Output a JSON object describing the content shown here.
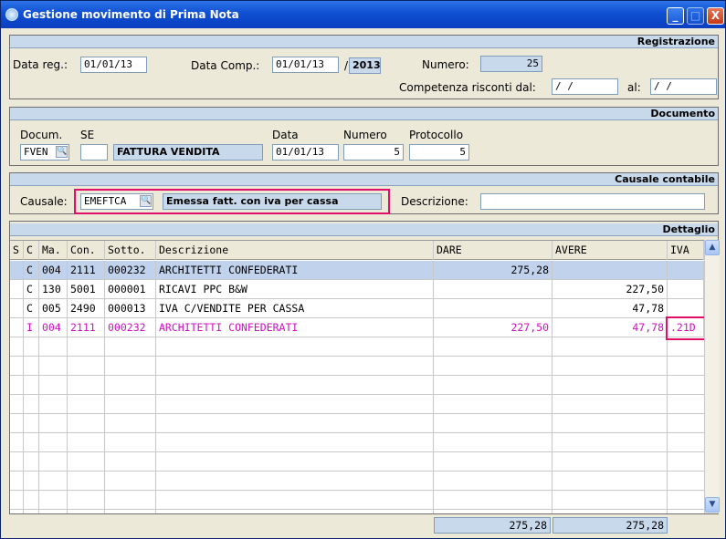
{
  "window": {
    "title": "Gestione movimento di Prima Nota",
    "minimize": "_",
    "maximize": "□",
    "close": "X"
  },
  "registrazione": {
    "header": "Registrazione",
    "data_reg_label": "Data reg.:",
    "data_reg": "01/01/13",
    "data_comp_label": "Data Comp.:",
    "data_comp": "01/01/13",
    "slash": "/",
    "anno": "2013",
    "numero_label": "Numero:",
    "numero": "25",
    "competenza_label": "Competenza risconti dal:",
    "competenza_dal": " /  / ",
    "al_label": "al:",
    "competenza_al": " /  / "
  },
  "documento": {
    "header": "Documento",
    "docum_label": "Docum.",
    "docum": "FVEN",
    "se_label": "SE",
    "se": "",
    "docum_desc": "FATTURA VENDITA",
    "data_label": "Data",
    "data": "01/01/13",
    "numero_label": "Numero",
    "numero": "5",
    "protocollo_label": "Protocollo",
    "protocollo": "5"
  },
  "causale": {
    "header": "Causale contabile",
    "causale_label": "Causale:",
    "causale": "EMEFTCA",
    "causale_desc": "Emessa fatt. con iva per cassa",
    "descrizione_label": "Descrizione:",
    "descrizione": ""
  },
  "dettaglio": {
    "header": "Dettaglio",
    "columns": [
      "S",
      "C",
      "Ma.",
      "Con.",
      "Sotto.",
      "Descrizione",
      "DARE",
      "AVERE",
      "IVA"
    ],
    "rows": [
      {
        "s": "",
        "c": "C",
        "ma": "004",
        "con": "2111",
        "sotto": "000232",
        "descr": "ARCHITETTI CONFEDERATI",
        "dare": "275,28",
        "avere": "",
        "iva": ""
      },
      {
        "s": "",
        "c": "C",
        "ma": "130",
        "con": "5001",
        "sotto": "000001",
        "descr": "RICAVI PPC B&W",
        "dare": "",
        "avere": "227,50",
        "iva": ""
      },
      {
        "s": "",
        "c": "C",
        "ma": "005",
        "con": "2490",
        "sotto": "000013",
        "descr": "IVA C/VENDITE PER CASSA",
        "dare": "",
        "avere": "47,78",
        "iva": ""
      },
      {
        "s": "",
        "c": "I",
        "ma": "004",
        "con": "2111",
        "sotto": "000232",
        "descr": "ARCHITETTI CONFEDERATI",
        "dare": "227,50",
        "avere": "47,78",
        "iva": ".21D"
      }
    ],
    "total_dare": "275,28",
    "total_avere": "275,28"
  }
}
